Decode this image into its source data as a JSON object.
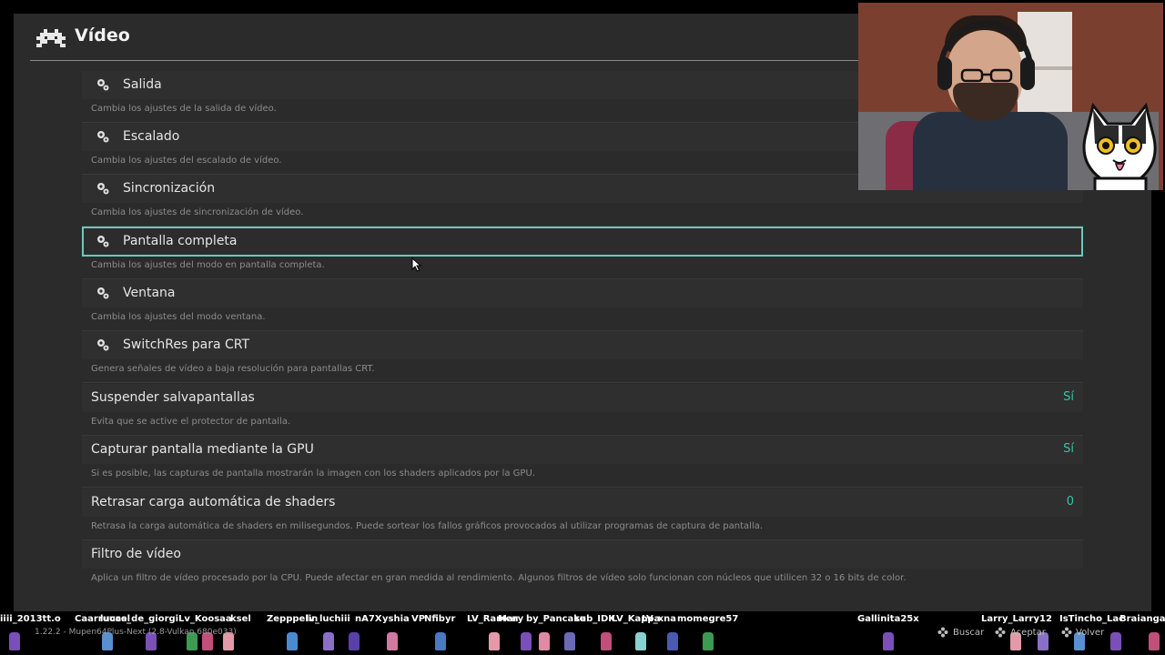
{
  "window": {
    "title": "Vídeo",
    "logo_icon": "retroarch-invader-icon"
  },
  "menu": {
    "items": [
      {
        "label": "Salida",
        "description": "Cambia los ajustes de la salida de vídeo.",
        "icon": "gear-icon"
      },
      {
        "label": "Escalado",
        "description": "Cambia los ajustes del escalado de vídeo.",
        "icon": "gear-icon"
      },
      {
        "label": "Sincronización",
        "description": "Cambia los ajustes de sincronización de vídeo.",
        "icon": "gear-icon"
      },
      {
        "label": "Pantalla completa",
        "description": "Cambia los ajustes del modo en pantalla completa.",
        "icon": "gear-icon",
        "selected": true
      },
      {
        "label": "Ventana",
        "description": "Cambia los ajustes del modo ventana.",
        "icon": "gear-icon"
      },
      {
        "label": "SwitchRes para CRT",
        "description": "Genera señales de vídeo a baja resolución para pantallas CRT.",
        "icon": "gear-icon"
      },
      {
        "label": "Suspender salvapantallas",
        "description": "Evita que se active el protector de pantalla.",
        "value": "Sí"
      },
      {
        "label": "Capturar pantalla mediante la GPU",
        "description": "Si es posible, las capturas de pantalla mostrarán la imagen con los shaders aplicados por la GPU.",
        "value": "Sí"
      },
      {
        "label": "Retrasar carga automática de shaders",
        "description": "Retrasa la carga automática de shaders en milisegundos. Puede sortear los fallos gráficos provocados al utilizar programas de captura de pantalla.",
        "value": "0"
      },
      {
        "label": "Filtro de vídeo",
        "description": "Aplica un filtro de vídeo procesado por la CPU. Puede afectar en gran medida al rendimiento. Algunos filtros de vídeo solo funcionan con núcleos que utilicen 32 o 16 bits de color."
      }
    ]
  },
  "footer": {
    "version": "1.22.2 - Mupen64Plus-Next (2.8-Vulkan 680e033)",
    "hints": [
      {
        "label": "Buscar",
        "icon": "controller-button-icon"
      },
      {
        "label": "Aceptar",
        "icon": "controller-button-icon"
      },
      {
        "label": "Volver",
        "icon": "controller-button-icon"
      }
    ]
  },
  "chat_overlay": {
    "names": [
      "iiii_2013tt.o",
      "Caarruucel",
      "lucas_de_giorgi",
      "Lv_Koosaa",
      "ksel",
      "Zepppelin",
      "lv_luchiii",
      "nA7X",
      "yshia",
      "VP",
      "Nfibyr",
      "LV_Ramen",
      "Mary",
      "by_Pancake",
      "sub_IDK",
      "LV_Kappa",
      "LV_xna",
      "momegre57",
      "Gallinita25x",
      "Larry_Larry12",
      "IsTincho_Lac",
      "Braiangar"
    ]
  },
  "colors": {
    "accent": "#34c6a5",
    "selection_border": "#6fc7bf",
    "background": "#2b2b2b"
  }
}
